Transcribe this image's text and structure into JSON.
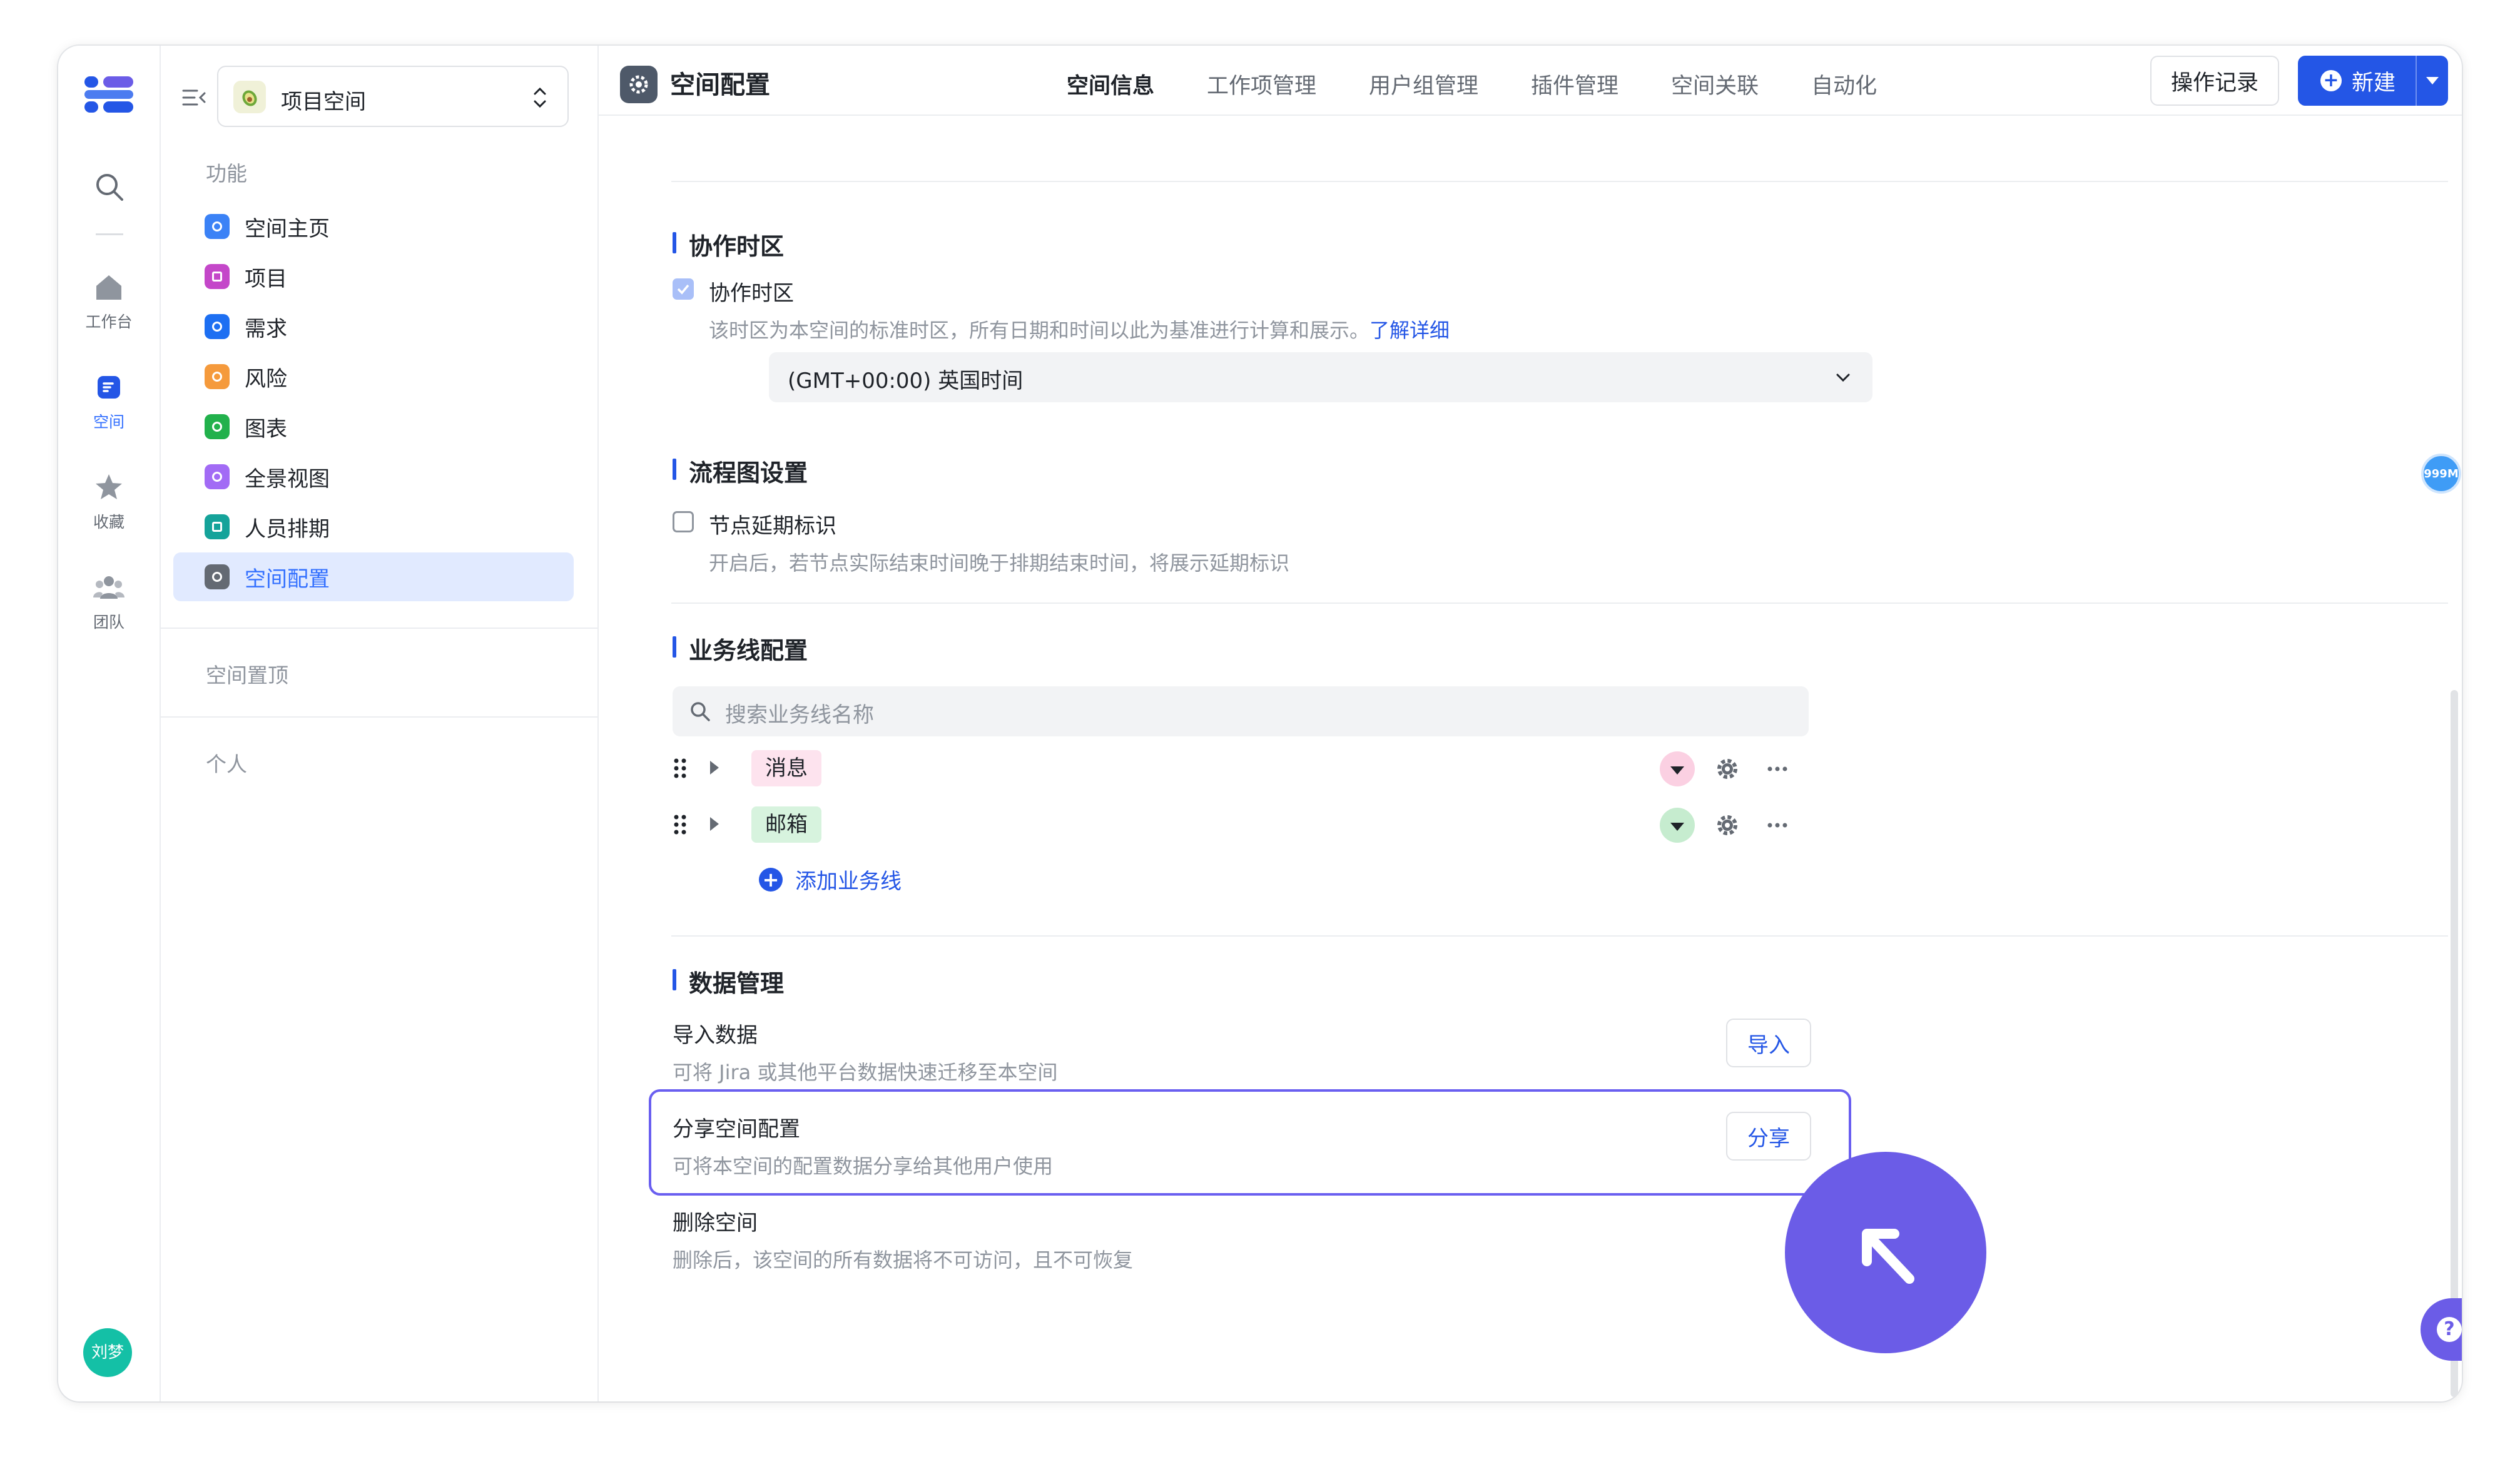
{
  "rail": {
    "items": [
      {
        "label": "工作台",
        "icon": "home-icon"
      },
      {
        "label": "空间",
        "icon": "space-icon",
        "active": true
      },
      {
        "label": "收藏",
        "icon": "star-icon"
      },
      {
        "label": "团队",
        "icon": "team-icon"
      }
    ],
    "avatar": "刘梦"
  },
  "nav": {
    "space_name": "项目空间",
    "section_features": "功能",
    "items": [
      {
        "label": "空间主页",
        "color": "#3b82f6"
      },
      {
        "label": "项目",
        "color": "#c447c9"
      },
      {
        "label": "需求",
        "color": "#1d6ff2"
      },
      {
        "label": "风险",
        "color": "#f59a3c"
      },
      {
        "label": "图表",
        "color": "#22b14c"
      },
      {
        "label": "全景视图",
        "color": "#a26bf5"
      },
      {
        "label": "人员排期",
        "color": "#15a39a"
      },
      {
        "label": "空间配置",
        "color": "#646a73",
        "active": true
      }
    ],
    "section_pinned": "空间置顶",
    "section_personal": "个人"
  },
  "header": {
    "title": "空间配置",
    "tabs": [
      "空间信息",
      "工作项管理",
      "用户组管理",
      "插件管理",
      "空间关联",
      "自动化"
    ],
    "active_tab": 0,
    "log_button": "操作记录",
    "new_button": "新建"
  },
  "timezone": {
    "title": "协作时区",
    "checkbox_label": "协作时区",
    "checked": true,
    "desc": "该时区为本空间的标准时区，所有日期和时间以此为基准进行计算和展示。",
    "link": "了解详细",
    "value": "(GMT+00:00) 英国时间"
  },
  "flow": {
    "title": "流程图设置",
    "checkbox_label": "节点延期标识",
    "checked": false,
    "desc": "开启后，若节点实际结束时间晚于排期结束时间，将展示延期标识"
  },
  "business": {
    "title": "业务线配置",
    "search_placeholder": "搜索业务线名称",
    "lines": [
      {
        "name": "消息",
        "bg": "#fde3ee",
        "dot": "#fbd0e2"
      },
      {
        "name": "邮箱",
        "bg": "#d7f3de",
        "dot": "#c6eccf"
      }
    ],
    "add_label": "添加业务线"
  },
  "data": {
    "title": "数据管理",
    "import_title": "导入数据",
    "import_desc": "可将 Jira 或其他平台数据快速迁移至本空间",
    "import_button": "导入",
    "share_title": "分享空间配置",
    "share_desc": "可将本空间的配置数据分享给其他用户使用",
    "share_button": "分享",
    "delete_title": "删除空间",
    "delete_desc": "删除后，该空间的所有数据将不可访问，且不可恢复"
  },
  "floating": {
    "badge": "999M",
    "help": "?"
  },
  "colors": {
    "accent": "#2456e6",
    "highlight": "#6b5ce7"
  }
}
